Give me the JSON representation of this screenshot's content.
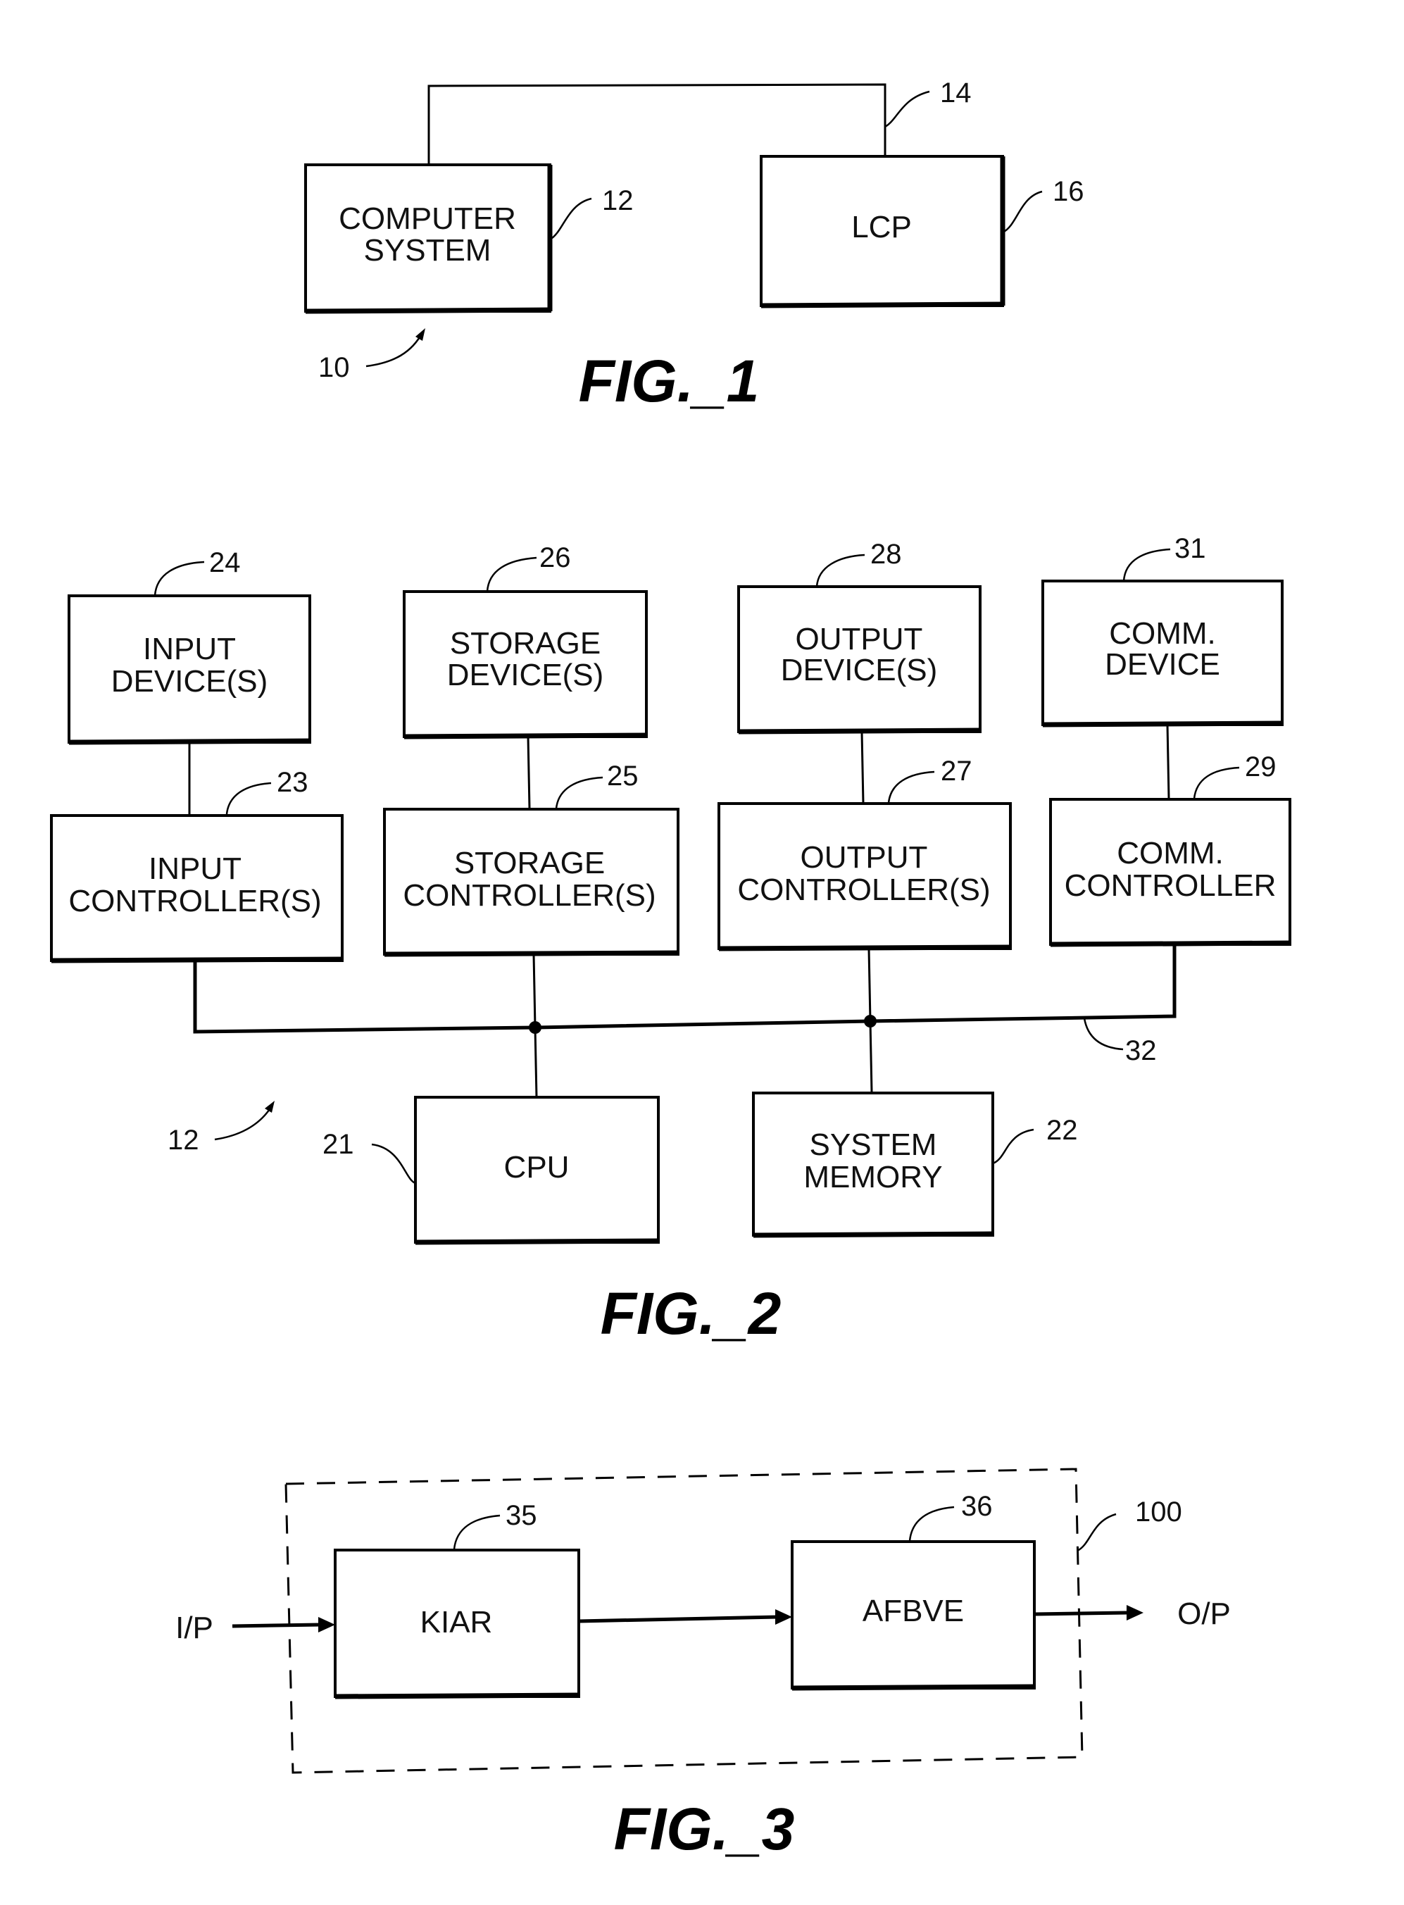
{
  "fig1": {
    "caption": "FIG._1",
    "computer_system": {
      "line1": "COMPUTER",
      "line2": "SYSTEM",
      "ref": "12"
    },
    "lcp": {
      "label": "LCP",
      "ref": "16"
    },
    "link_ref": "14",
    "system_ref": "10"
  },
  "fig2": {
    "caption": "FIG._2",
    "system_ref": "12",
    "bus_ref": "32",
    "input_device": {
      "line1": "INPUT",
      "line2": "DEVICE(S)",
      "ref": "24"
    },
    "storage_device": {
      "line1": "STORAGE",
      "line2": "DEVICE(S)",
      "ref": "26"
    },
    "output_device": {
      "line1": "OUTPUT",
      "line2": "DEVICE(S)",
      "ref": "28"
    },
    "comm_device": {
      "line1": "COMM.",
      "line2": "DEVICE",
      "ref": "31"
    },
    "input_controller": {
      "line1": "INPUT",
      "line2": "CONTROLLER(S)",
      "ref": "23"
    },
    "storage_controller": {
      "line1": "STORAGE",
      "line2": "CONTROLLER(S)",
      "ref": "25"
    },
    "output_controller": {
      "line1": "OUTPUT",
      "line2": "CONTROLLER(S)",
      "ref": "27"
    },
    "comm_controller": {
      "line1": "COMM.",
      "line2": "CONTROLLER",
      "ref": "29"
    },
    "cpu": {
      "label": "CPU",
      "ref": "21"
    },
    "system_memory": {
      "line1": "SYSTEM",
      "line2": "MEMORY",
      "ref": "22"
    }
  },
  "fig3": {
    "caption": "FIG._3",
    "input_label": "I/P",
    "output_label": "O/P",
    "kiar": {
      "label": "KIAR",
      "ref": "35"
    },
    "afbve": {
      "label": "AFBVE",
      "ref": "36"
    },
    "enclosure_ref": "100"
  }
}
